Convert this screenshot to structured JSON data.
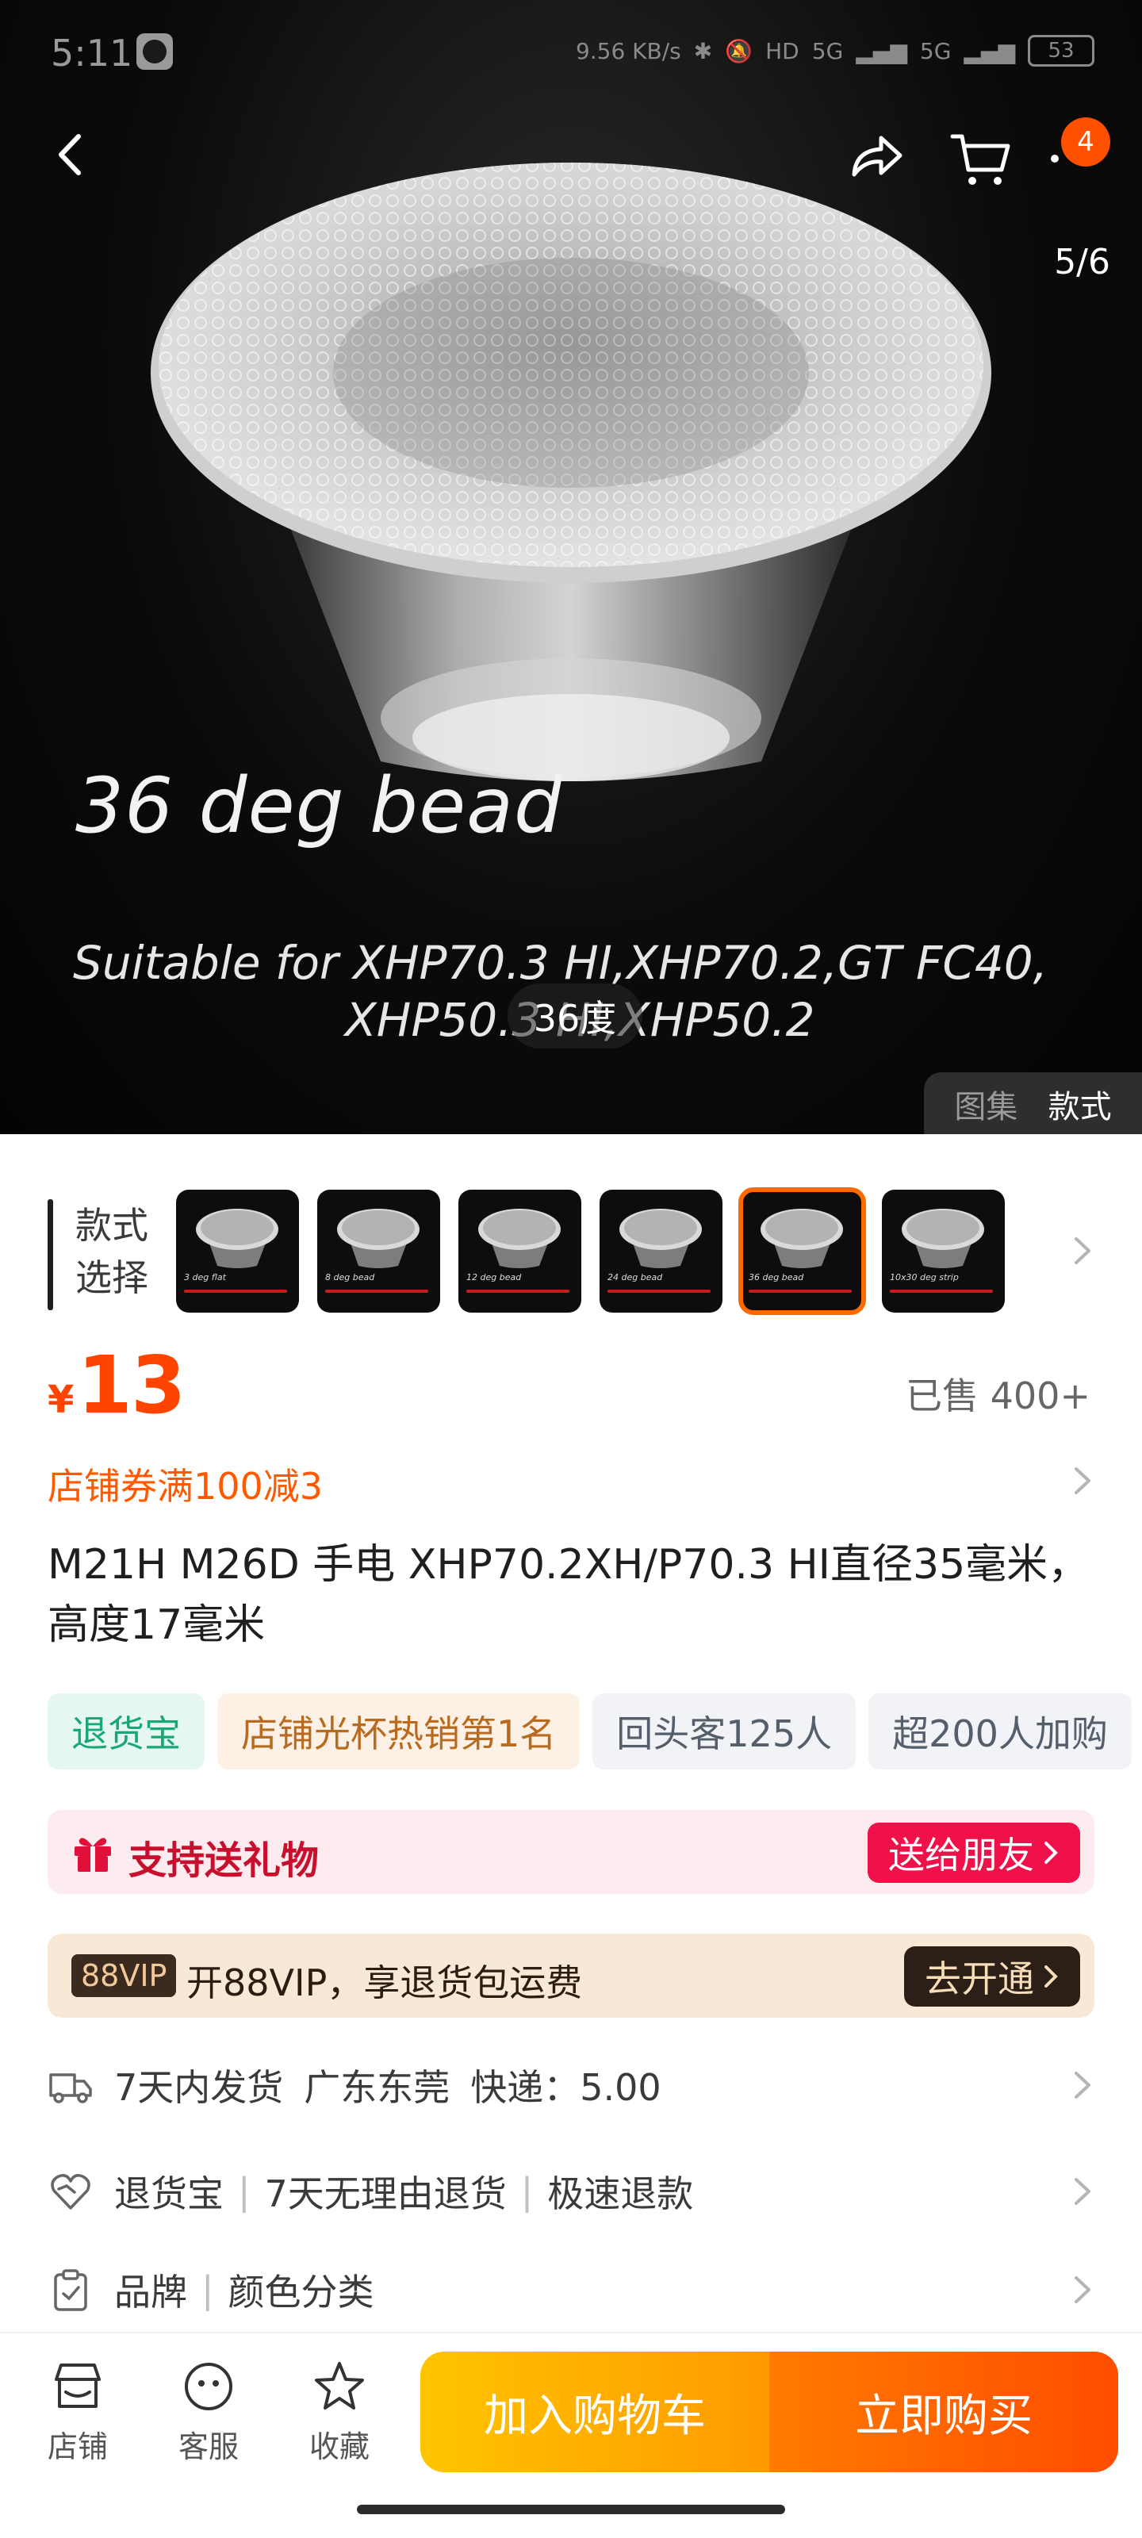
{
  "status_bar": {
    "time": "5:11",
    "network_speed": "9.56 KB/s",
    "hd": "HD",
    "signal1": "5G",
    "signal2": "5G",
    "battery": "53"
  },
  "header": {
    "cart_count": "4",
    "image_counter": "5/6"
  },
  "hero": {
    "caption_title": "36 deg bead",
    "caption_line1": "Suitable for XHP70.3 HI,XHP70.2,GT FC40,",
    "caption_line2": "XHP50.3 HI,XHP50.2",
    "style_pill": "36度",
    "gallery_tab": "图集",
    "style_tab": "款式"
  },
  "variants": {
    "label_line1": "款式",
    "label_line2": "选择",
    "items": [
      {
        "label": "3 deg flat",
        "selected": false
      },
      {
        "label": "8 deg bead",
        "selected": false
      },
      {
        "label": "12 deg bead",
        "selected": false
      },
      {
        "label": "24 deg bead",
        "selected": false
      },
      {
        "label": "36 deg bead",
        "selected": true
      },
      {
        "label": "10x30 deg strip",
        "selected": false
      }
    ]
  },
  "price": {
    "currency": "¥",
    "value": "13",
    "sold": "已售 400+"
  },
  "coupon": "店铺券满100减3",
  "title": "M21H M26D 手电 XHP70.2XH/P70.3 HI直径35毫米，高度17毫米",
  "tags": [
    "退货宝",
    "店铺光杯热销第1名",
    "回头客125人",
    "超200人加购"
  ],
  "gift": {
    "text": "支持送礼物",
    "button": "送给朋友"
  },
  "vip": {
    "badge": "88VIP",
    "text": "开88VIP，享退货包运费",
    "button": "去开通"
  },
  "info_rows": {
    "shipping": [
      "7天内发货",
      "广东东莞",
      "快递：5.00"
    ],
    "returns": [
      "退货宝",
      "7天无理由退货",
      "极速退款"
    ],
    "specs": [
      "品牌",
      "颜色分类"
    ]
  },
  "bottom_bar": {
    "shop": "店铺",
    "service": "客服",
    "favorite": "收藏",
    "add_to_cart": "加入购物车",
    "buy_now": "立即购买"
  },
  "colors": {
    "accent": "#ff5000",
    "price": "#ff4400",
    "gift_button": "#f0104a"
  }
}
